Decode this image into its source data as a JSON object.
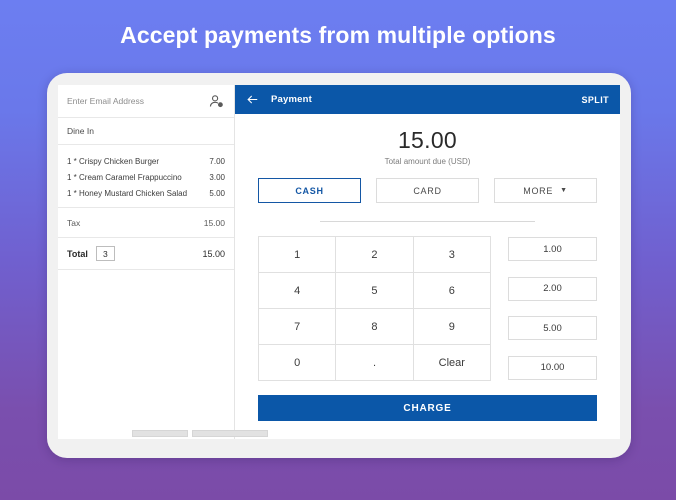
{
  "promo": {
    "headline": "Accept payments from multiple options"
  },
  "order_panel": {
    "email_placeholder": "Enter Email Address",
    "person_add_icon": "person-add-icon",
    "order_type": "Dine In",
    "items": [
      {
        "name": "1 * Crispy Chicken Burger",
        "price": "7.00"
      },
      {
        "name": "1 * Cream Caramel Frappuccino",
        "price": "3.00"
      },
      {
        "name": "1 * Honey Mustard Chicken Salad",
        "price": "5.00"
      }
    ],
    "tax_label": "Tax",
    "tax_amount": "15.00",
    "total_label": "Total",
    "total_count": "3",
    "total_amount": "15.00"
  },
  "appbar": {
    "back_icon": "arrow-left-icon",
    "title": "Payment",
    "action_label": "SPLIT",
    "background_color": "#0b57a8"
  },
  "amount": {
    "value": "15.00",
    "caption": "Total amount due (USD)"
  },
  "methods": [
    {
      "label": "CASH",
      "selected": true
    },
    {
      "label": "CARD",
      "selected": false
    },
    {
      "label": "MORE",
      "selected": false,
      "caret_icon": "chevron-down-icon",
      "caret": "▼"
    }
  ],
  "keypad": {
    "keys": [
      "1",
      "2",
      "3",
      "4",
      "5",
      "6",
      "7",
      "8",
      "9",
      "0",
      ".",
      "Clear"
    ]
  },
  "quick_amounts": [
    "1.00",
    "2.00",
    "5.00",
    "10.00"
  ],
  "charge": {
    "label": "CHARGE",
    "color": "#0b57a8"
  },
  "theme": {
    "accent_blue": "#0b57a8",
    "selected_blue": "#1457a5",
    "bg_gradient_top": "#6c7ef1",
    "bg_gradient_bottom": "#7b4ba8"
  }
}
